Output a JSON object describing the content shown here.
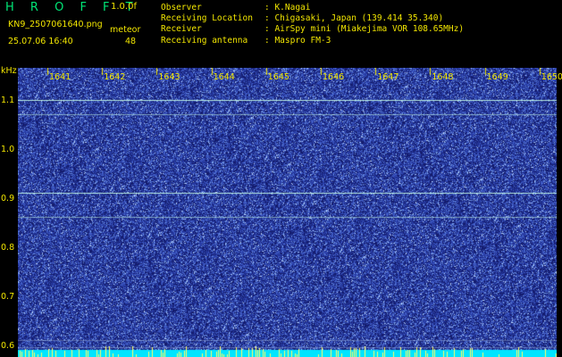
{
  "header": {
    "title": "H R O F F T",
    "version": "1.0.0f",
    "filename": "KN9_2507061640.png",
    "datetime": "25.07.06 16:40",
    "meteor_label": "meteor",
    "meteor_count": "48"
  },
  "info": [
    {
      "key": "Observer",
      "value": ": K.Nagai"
    },
    {
      "key": "Receiving Location",
      "value": ": Chigasaki, Japan (139.414 35.340)"
    },
    {
      "key": "Receiver",
      "value": ": AirSpy mini (Miakejima VOR 108.65MHz)"
    },
    {
      "key": "Receiving antenna",
      "value": ": Maspro FM-3"
    }
  ],
  "chart_data": {
    "type": "heatmap",
    "ylabel": "kHz",
    "x_ticks": [
      "1641",
      "1642",
      "1643",
      "1644",
      "1645",
      "1646",
      "1647",
      "1648",
      "1649",
      "1650"
    ],
    "y_ticks": [
      "1.1",
      "1.0",
      "0.9",
      "0.8",
      "0.7",
      "0.6"
    ],
    "ylim": [
      0.58,
      1.17
    ],
    "lines_khz": [
      1.105,
      1.075,
      0.915,
      0.865,
      0.615,
      0.6
    ],
    "colors": {
      "background": "#1f2a8c",
      "noise_bright": "#8ab4ff",
      "line": "#c8ffe8",
      "baseline": "#00e5ff",
      "meteor_spike": "#ffff66"
    }
  }
}
